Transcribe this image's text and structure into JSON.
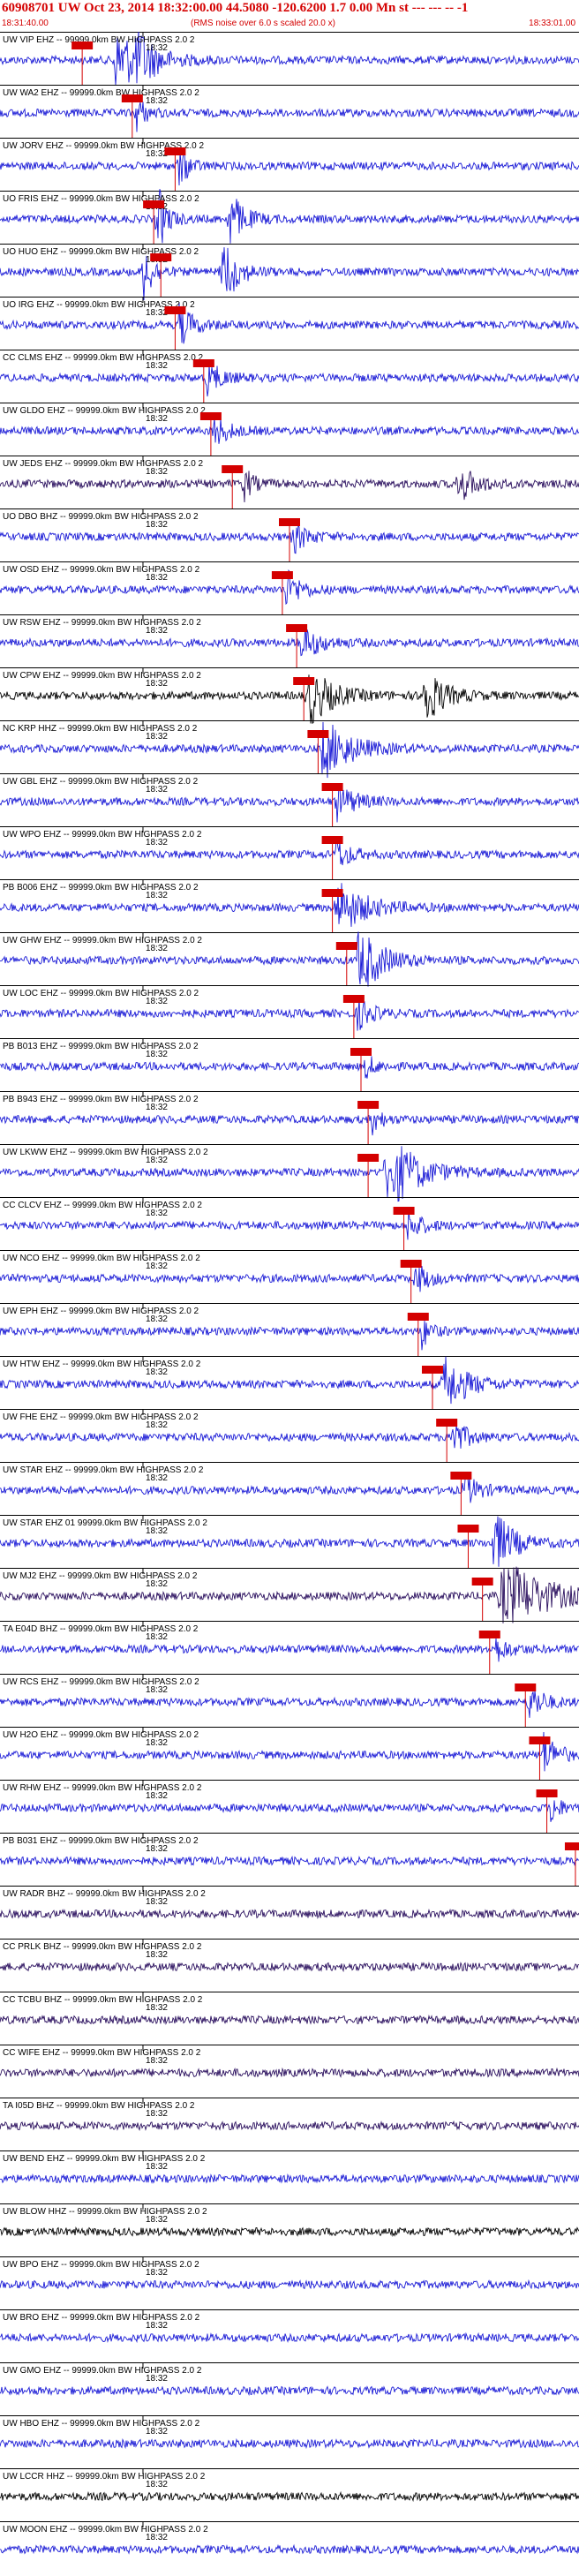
{
  "header": {
    "title": "60908701 UW Oct 23, 2014 18:32:00.00   44.5080 -120.6200  1.7 0.00 Mn st --- --- --   -1",
    "end_marker": "-1",
    "start_time": "18:31:40.00",
    "note": "(RMS noise over 6.0 s scaled 20.0 x)",
    "end_time": "18:33:01.00"
  },
  "colors": {
    "trace": "#1a1ad6",
    "trace_dark": "#000000",
    "trace_purple": "#2a0f5e",
    "pick": "#d40000",
    "text": "#000000"
  },
  "chart_data": {
    "type": "line",
    "title": "60908701 UW Oct 23, 2014 18:32:00.00   44.5080 -120.6200  1.7 0.00 Mn st --- --- --",
    "x_range": [
      "18:31:40.00",
      "18:33:01.00"
    ],
    "tick_label": "18:32",
    "series": [
      {
        "name": "UW VIP EHZ -- 99999.0km BW  HIGHPASS  2.0  2",
        "color": "blue",
        "pick": 11.5,
        "bursts": [
          [
            16,
            6,
            2.2
          ],
          [
            19,
            3,
            1.6
          ]
        ]
      },
      {
        "name": "UW WA2 EHZ -- 99999.0km BW  HIGHPASS  2.0  2",
        "color": "blue",
        "pick": 18.5,
        "bursts": [
          [
            19,
            2,
            1.2
          ],
          [
            90,
            5,
            2.6
          ]
        ]
      },
      {
        "name": "UW JORV EHZ -- 99999.0km BW  HIGHPASS  2.0  2",
        "color": "blue",
        "pick": 24.5,
        "bursts": [
          [
            25,
            2,
            1.5
          ]
        ]
      },
      {
        "name": "UO FRIS EHZ -- 99999.0km BW  HIGHPASS  2.0  2",
        "color": "blue",
        "pick": 21.5,
        "bursts": [
          [
            22,
            2,
            2.4
          ],
          [
            32,
            3,
            2
          ]
        ]
      },
      {
        "name": "UO HUO EHZ -- 99999.0km BW  HIGHPASS  2.0  2",
        "color": "blue",
        "pick": 22.5,
        "bursts": [
          [
            20,
            2,
            2.2
          ],
          [
            31,
            3,
            2.6
          ]
        ]
      },
      {
        "name": "UO IRG EHZ -- 99999.0km BW  HIGHPASS  2.0  2",
        "color": "blue",
        "pick": 24.5,
        "bursts": [
          [
            25,
            3,
            1.4
          ]
        ]
      },
      {
        "name": "CC CLMS EHZ -- 99999.0km BW  HIGHPASS  2.0  2",
        "color": "blue",
        "pick": 28.5,
        "bursts": [
          [
            29,
            3,
            1.1
          ]
        ]
      },
      {
        "name": "UW GLDO EHZ -- 99999.0km BW  HIGHPASS  2.0  2",
        "color": "blue",
        "pick": 29.5,
        "bursts": [
          [
            30,
            3,
            1
          ]
        ]
      },
      {
        "name": "UW JEDS EHZ -- 99999.0km BW  HIGHPASS  2.0  2",
        "color": "purple",
        "pick": 32.5,
        "bursts": [
          [
            34,
            2,
            1.2
          ],
          [
            64,
            4,
            1.2
          ]
        ]
      },
      {
        "name": "UO DBO BHZ -- 99999.0km BW  HIGHPASS  2.0  2",
        "color": "blue",
        "pick": 40.5,
        "bursts": [
          [
            41,
            3,
            1
          ]
        ]
      },
      {
        "name": "UW OSD EHZ -- 99999.0km BW  HIGHPASS  2.0  2",
        "color": "blue",
        "pick": 39.5,
        "bursts": [
          [
            40,
            3,
            1.3
          ]
        ]
      },
      {
        "name": "UW RSW EHZ -- 99999.0km BW  HIGHPASS  2.0  2",
        "color": "blue",
        "pick": 41.5,
        "bursts": [
          [
            42,
            4,
            1.2
          ]
        ]
      },
      {
        "name": "UW CPW EHZ -- 99999.0km BW  HIGHPASS  2.0  2",
        "color": "black",
        "pick": 42.5,
        "bursts": [
          [
            43,
            5,
            2
          ],
          [
            59,
            4,
            2.2
          ]
        ]
      },
      {
        "name": "NC KRP HHZ -- 99999.0km BW  HIGHPASS  2.0  2",
        "color": "blue",
        "pick": 44.5,
        "bursts": [
          [
            45,
            6,
            2
          ]
        ]
      },
      {
        "name": "UW GBL EHZ -- 99999.0km BW  HIGHPASS  2.0  2",
        "color": "blue",
        "pick": 46.5,
        "bursts": [
          [
            47,
            4,
            1.2
          ]
        ]
      },
      {
        "name": "UW WPO EHZ -- 99999.0km BW  HIGHPASS  2.0  2",
        "color": "blue",
        "pick": 46.5,
        "bursts": [
          [
            47,
            3,
            1
          ],
          [
            82,
            3,
            1.1
          ]
        ]
      },
      {
        "name": "PB B006 EHZ -- 99999.0km BW  HIGHPASS  2.0  2",
        "color": "blue",
        "pick": 46.5,
        "bursts": [
          [
            47,
            6,
            1.8
          ]
        ]
      },
      {
        "name": "UW GHW EHZ -- 99999.0km BW  HIGHPASS  2.0  2",
        "color": "blue",
        "pick": 48.5,
        "bursts": [
          [
            50,
            5,
            2.4
          ]
        ]
      },
      {
        "name": "UW LOC EHZ -- 99999.0km BW  HIGHPASS  2.0  2",
        "color": "blue",
        "pick": 49.5,
        "bursts": [
          [
            50,
            3,
            1
          ]
        ]
      },
      {
        "name": "PB B013 EHZ -- 99999.0km BW  HIGHPASS  2.0  2",
        "color": "blue",
        "pick": 50.5,
        "bursts": [
          [
            51,
            2,
            0.9
          ]
        ]
      },
      {
        "name": "PB B943 EHZ -- 99999.0km BW  HIGHPASS  2.0  2",
        "color": "blue",
        "pick": 51.5,
        "bursts": [
          [
            52,
            2,
            0.9
          ]
        ]
      },
      {
        "name": "UW LKWW EHZ -- 99999.0km BW  HIGHPASS  2.0  2",
        "color": "blue",
        "pick": 51.5,
        "bursts": [
          [
            54,
            6,
            2.8
          ],
          [
            88,
            10,
            3
          ]
        ]
      },
      {
        "name": "CC CLCV EHZ -- 99999.0km BW  HIGHPASS  2.0  2",
        "color": "blue",
        "pick": 56.5,
        "bursts": [
          [
            57,
            3,
            1
          ]
        ]
      },
      {
        "name": "UW NCO EHZ -- 99999.0km BW  HIGHPASS  2.0  2",
        "color": "blue",
        "pick": 57.5,
        "bursts": [
          [
            58,
            3,
            1
          ]
        ]
      },
      {
        "name": "UW EPH EHZ -- 99999.0km BW  HIGHPASS  2.0  2",
        "color": "blue",
        "pick": 58.5,
        "bursts": [
          [
            59,
            2,
            1
          ]
        ]
      },
      {
        "name": "UW HTW EHZ -- 99999.0km BW  HIGHPASS  2.0  2",
        "color": "blue",
        "pick": 60.5,
        "bursts": [
          [
            62,
            5,
            1.8
          ]
        ]
      },
      {
        "name": "UW FHE EHZ -- 99999.0km BW  HIGHPASS  2.0  2",
        "color": "blue",
        "pick": 62.5,
        "bursts": [
          [
            63,
            3,
            1.4
          ]
        ]
      },
      {
        "name": "UW STAR EHZ -- 99999.0km BW  HIGHPASS  2.0  2",
        "color": "blue",
        "pick": 64.5,
        "bursts": [
          [
            65,
            3,
            1
          ]
        ]
      },
      {
        "name": "UW STAR EHZ 01 99999.0km BW  HIGHPASS  2.0  2",
        "color": "blue",
        "pick": 65.5,
        "bursts": [
          [
            69,
            4,
            2.2
          ]
        ]
      },
      {
        "name": "UW MJ2 EHZ -- 99999.0km BW  HIGHPASS  2.0  2",
        "color": "purple",
        "pick": 67.5,
        "bursts": [
          [
            70,
            9,
            2.6
          ]
        ]
      },
      {
        "name": "TA E04D BHZ -- 99999.0km BW  HIGHPASS  2.0  2",
        "color": "blue",
        "pick": 68.5,
        "bursts": [
          [
            69,
            3,
            0.9
          ]
        ]
      },
      {
        "name": "UW RCS EHZ -- 99999.0km BW  HIGHPASS  2.0  2",
        "color": "blue",
        "pick": 73.5,
        "bursts": [
          [
            74,
            3,
            1.2
          ]
        ]
      },
      {
        "name": "UW H2O EHZ -- 99999.0km BW  HIGHPASS  2.0  2",
        "color": "blue",
        "pick": 75.5,
        "bursts": [
          [
            76,
            3,
            1.4
          ]
        ]
      },
      {
        "name": "UW RHW EHZ -- 99999.0km BW  HIGHPASS  2.0  2",
        "color": "blue",
        "pick": 76.5,
        "bursts": [
          [
            77,
            2,
            1
          ]
        ]
      },
      {
        "name": "PB B031 EHZ -- 99999.0km BW  HIGHPASS  2.0  2",
        "color": "blue",
        "pick": 80.5,
        "bursts": []
      },
      {
        "name": "UW RADR BHZ -- 99999.0km BW  HIGHPASS  2.0  2",
        "color": "purple",
        "pick": null,
        "bursts": []
      },
      {
        "name": "CC PRLK BHZ -- 99999.0km BW  HIGHPASS  2.0  2",
        "color": "purple",
        "pick": null,
        "bursts": []
      },
      {
        "name": "CC TCBU BHZ -- 99999.0km BW  HIGHPASS  2.0  2",
        "color": "purple",
        "pick": null,
        "bursts": []
      },
      {
        "name": "CC WIFE EHZ -- 99999.0km BW  HIGHPASS  2.0  2",
        "color": "purple",
        "pick": null,
        "bursts": []
      },
      {
        "name": "TA I05D BHZ -- 99999.0km BW  HIGHPASS  2.0  2",
        "color": "purple",
        "pick": null,
        "bursts": []
      },
      {
        "name": "UW BEND EHZ -- 99999.0km BW  HIGHPASS  2.0  2",
        "color": "blue",
        "pick": null,
        "bursts": []
      },
      {
        "name": "UW BLOW HHZ -- 99999.0km BW  HIGHPASS  2.0  2",
        "color": "black",
        "pick": null,
        "bursts": []
      },
      {
        "name": "UW BPO EHZ -- 99999.0km BW  HIGHPASS  2.0  2",
        "color": "blue",
        "pick": null,
        "bursts": []
      },
      {
        "name": "UW BRO EHZ -- 99999.0km BW  HIGHPASS  2.0  2",
        "color": "blue",
        "pick": null,
        "bursts": []
      },
      {
        "name": "UW GMO EHZ -- 99999.0km BW  HIGHPASS  2.0  2",
        "color": "blue",
        "pick": null,
        "bursts": []
      },
      {
        "name": "UW HBO EHZ -- 99999.0km BW  HIGHPASS  2.0  2",
        "color": "blue",
        "pick": null,
        "bursts": []
      },
      {
        "name": "UW LCCR HHZ -- 99999.0km BW  HIGHPASS  2.0  2",
        "color": "black",
        "pick": null,
        "bursts": []
      },
      {
        "name": "UW MOON EHZ -- 99999.0km BW  HIGHPASS  2.0  2",
        "color": "blue",
        "pick": null,
        "bursts": []
      }
    ]
  }
}
